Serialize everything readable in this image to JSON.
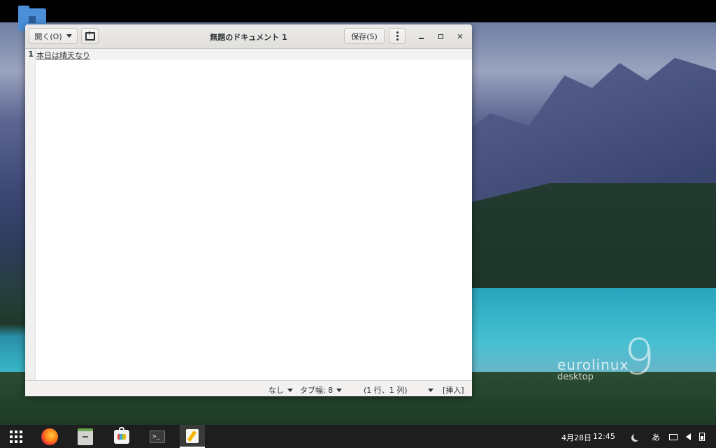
{
  "window": {
    "title": "無題のドキュメント 1",
    "open_label": "開く(O)",
    "save_label": "保存(S)"
  },
  "editor": {
    "line_number": "1",
    "line_text": "本日は晴天なり"
  },
  "statusbar": {
    "syntax": "なし",
    "tab_width": "タブ幅: 8",
    "position": "(1 行、1 列)",
    "mode": "[挿入]"
  },
  "desktop": {
    "brand_name": "eurolinux",
    "brand_sub": "desktop",
    "brand_version": "9"
  },
  "taskbar": {
    "date": "4月28日",
    "time": "12:45",
    "input_method": "あ",
    "apps": [
      "app-grid-icon",
      "firefox-icon",
      "files-icon",
      "software-store-icon",
      "terminal-icon",
      "text-editor-icon"
    ]
  }
}
